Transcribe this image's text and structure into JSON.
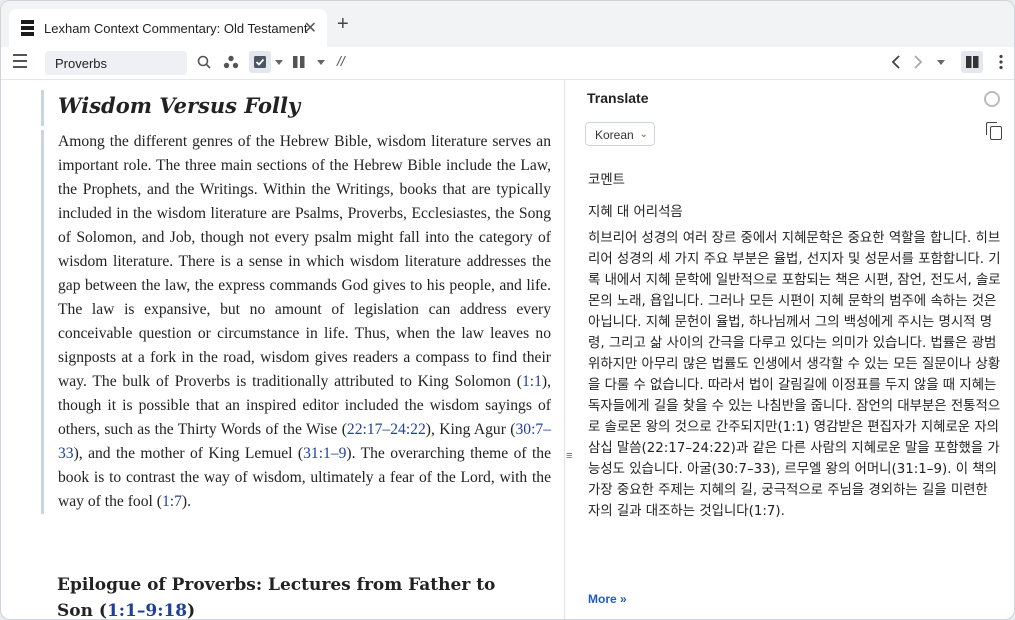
{
  "tab": {
    "title": "Lexham Context Commentary: Old Testament",
    "close_glyph": "✕",
    "new_glyph": "+"
  },
  "toolbar": {
    "search_value": "Proverbs",
    "divider_text": "//"
  },
  "article": {
    "title": "Wisdom Versus Folly",
    "p1": "Among the different genres of the Hebrew Bible, wisdom literature serves an important role. The three main sections of the Hebrew Bible include the Law, the Prophets, and the Writings. Within the Writings, books that are typically included in the wisdom literature are Psalms, Proverbs, Ecclesiastes, the Song of Solomon, and Job, though not every psalm might fall into the category of wisdom literature. There is a sense in which wisdom literature addresses the gap between the law, the express commands God gives to his people, and life. The law is expansive, but no amount of legislation can address every conceivable question or circumstance in life. Thus, when the law leaves no signposts at a fork in the road, wisdom gives readers a compass to find their way. The bulk of Proverbs is traditionally attributed to King Solomon (",
    "ref1": "1:1",
    "p2": "), though it is possible that an inspired editor included the wisdom sayings of others, such as the Thirty Words of the Wise (",
    "ref2": "22:17–24:22",
    "p3": "), King Agur (",
    "ref3": "30:7–33",
    "p4": "), and the mother of King Lemuel (",
    "ref4": "31:1–9",
    "p5": "). The overarching theme of the book is to contrast the way of wisdom, ultimately a fear of the Lord, with the way of the fool (",
    "ref5": "1:7",
    "p6": ").",
    "subhead": "Epilogue of Proverbs: Lectures from Father to Son (",
    "subhead_ref": "1:1–9:18",
    "subhead_end": ")"
  },
  "translate": {
    "heading": "Translate",
    "language": "Korean",
    "line1": "코멘트",
    "line2": "지혜 대 어리석음",
    "body": "히브리어 성경의 여러 장르 중에서 지혜문학은 중요한 역할을 합니다. 히브리어 성경의 세 가지 주요 부분은 율법, 선지자 및 성문서를 포함합니다. 기록 내에서 지혜 문학에 일반적으로 포함되는 책은 시편, 잠언, 전도서, 솔로몬의 노래, 욥입니다. 그러나 모든 시편이 지혜 문학의 범주에 속하는 것은 아닙니다. 지혜 문헌이 율법, 하나님께서 그의 백성에게 주시는 명시적 명령, 그리고 삶 사이의 간극을 다루고 있다는 의미가 있습니다. 법률은 광범위하지만 아무리 많은 법률도 인생에서 생각할 수 있는 모든 질문이나 상황을 다룰 수 없습니다. 따라서 법이 갈림길에 이정표를 두지 않을 때 지혜는 독자들에게 길을 찾을 수 있는 나침반을 줍니다. 잠언의 대부분은 전통적으로 솔로몬 왕의 것으로 간주되지만(1:1) 영감받은 편집자가 지혜로운 자의 삼십 말씀(22:17–24:22)과 같은 다른 사람의 지혜로운 말을 포함했을 가능성도 있습니다. 아굴(30:7–33), 르무엘 왕의 어머니(31:1–9). 이 책의 가장 중요한 주제는 지혜의 길, 궁극적으로 주님을 경외하는 길을 미련한 자의 길과 대조하는 것입니다(1:7).",
    "more": "More »"
  },
  "colors": {
    "link": "#1f3f9a",
    "more_link": "#1f5bc7",
    "accent_bar": "#c9d5e2"
  }
}
